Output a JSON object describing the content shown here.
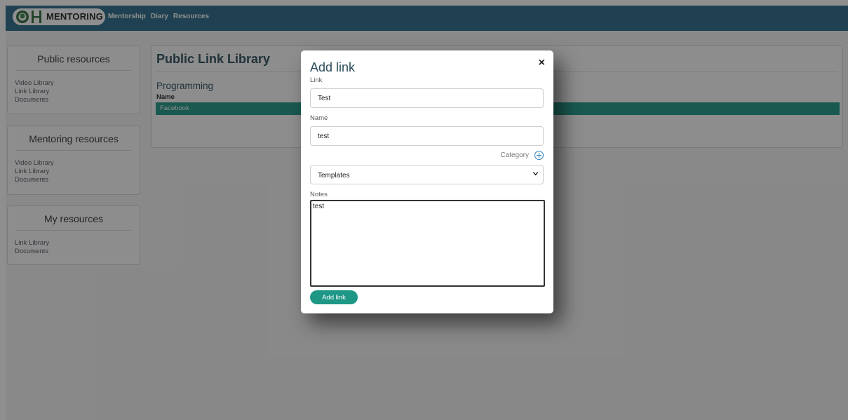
{
  "navbar": {
    "logo_text": "MENTORING",
    "links": [
      "Mentorship",
      "Diary",
      "Resources"
    ]
  },
  "sidebar": {
    "public": {
      "title": "Public resources",
      "items": [
        "Video Library",
        "Link Library",
        "Documents"
      ]
    },
    "mentoring": {
      "title": "Mentoring resources",
      "items": [
        "Video Library",
        "Link Library",
        "Documents"
      ]
    },
    "mine": {
      "title": "My resources",
      "items": [
        "Link Library",
        "Documents"
      ]
    }
  },
  "main": {
    "title": "Public Link Library",
    "section": "Programming",
    "column_header": "Name",
    "rows": [
      "Facebook"
    ]
  },
  "modal": {
    "title": "Add link",
    "close_glyph": "×",
    "link_label": "Link",
    "link_value": "Test",
    "name_label": "Name",
    "name_value": "test",
    "category_label": "Category",
    "category_value": "Templates",
    "notes_label": "Notes",
    "notes_value": "test",
    "submit_label": "Add link"
  },
  "colors": {
    "navbar": "#2a6a88",
    "accent": "#1e9786",
    "heading": "#2b4d5c"
  },
  "icons": [
    "logo-icon",
    "close-icon",
    "add-category-icon",
    "chevron-down-icon"
  ]
}
